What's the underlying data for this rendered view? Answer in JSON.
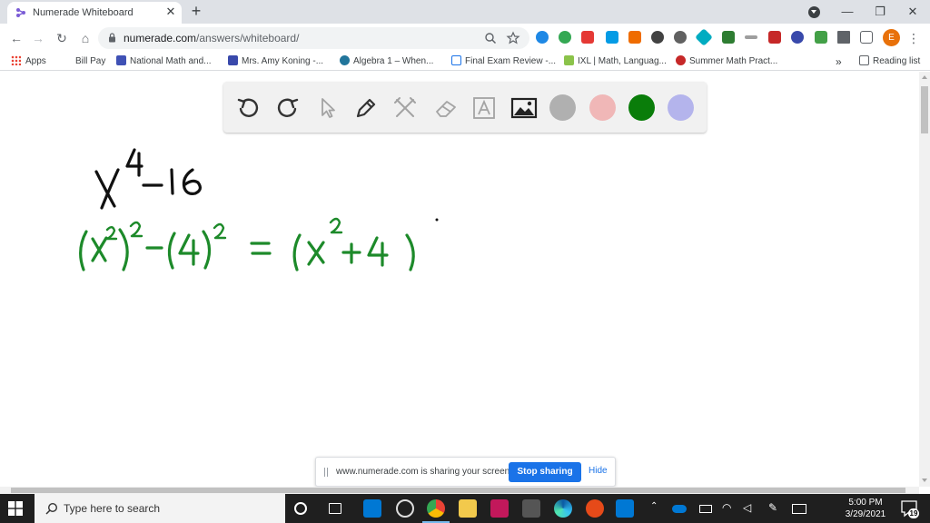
{
  "browser": {
    "tab": {
      "title": "Numerade Whiteboard",
      "favicon": "numerade-logo-icon",
      "close_glyph": "✕"
    },
    "new_tab_glyph": "+",
    "window_controls": {
      "minimize": "—",
      "restore": "❐",
      "close": "✕"
    },
    "url_host": "numerade.com",
    "url_path": "/answers/whiteboard/",
    "nav": {
      "back": "←",
      "forward": "→",
      "reload": "↻",
      "home": "⌂"
    },
    "omnibox_icons": [
      "zoom-icon",
      "bookmark-star-icon"
    ],
    "profile_initial": "E",
    "menu_glyph": "⋮"
  },
  "bookmarks": [
    {
      "label": "Apps"
    },
    {
      "label": "Bill Pay"
    },
    {
      "label": "National Math and..."
    },
    {
      "label": "Mrs. Amy Koning -..."
    },
    {
      "label": "Algebra 1 – When..."
    },
    {
      "label": "Final Exam Review -..."
    },
    {
      "label": "IXL | Math, Languag..."
    },
    {
      "label": "Summer Math Pract..."
    }
  ],
  "bookmarks_overflow": "»",
  "reading_list": "Reading list",
  "whiteboard": {
    "tools": [
      "undo-icon",
      "redo-icon",
      "pointer-icon",
      "pen-icon",
      "tools-icon",
      "eraser-icon",
      "text-icon",
      "image-icon"
    ],
    "colors": [
      {
        "name": "gray",
        "hex": "#b0b0b0"
      },
      {
        "name": "pink",
        "hex": "#f0b7b7"
      },
      {
        "name": "green",
        "hex": "#0a7d0a"
      },
      {
        "name": "lavender",
        "hex": "#b4b4ec"
      }
    ],
    "ink": {
      "black": "#111111",
      "green": "#1d8a2a"
    }
  },
  "share_bar": {
    "message": "www.numerade.com is sharing your screen.",
    "stop_label": "Stop sharing",
    "hide_label": "Hide"
  },
  "taskbar": {
    "search_placeholder": "Type here to search",
    "time": "5:00 PM",
    "date": "3/29/2021",
    "notification_count": "19"
  }
}
